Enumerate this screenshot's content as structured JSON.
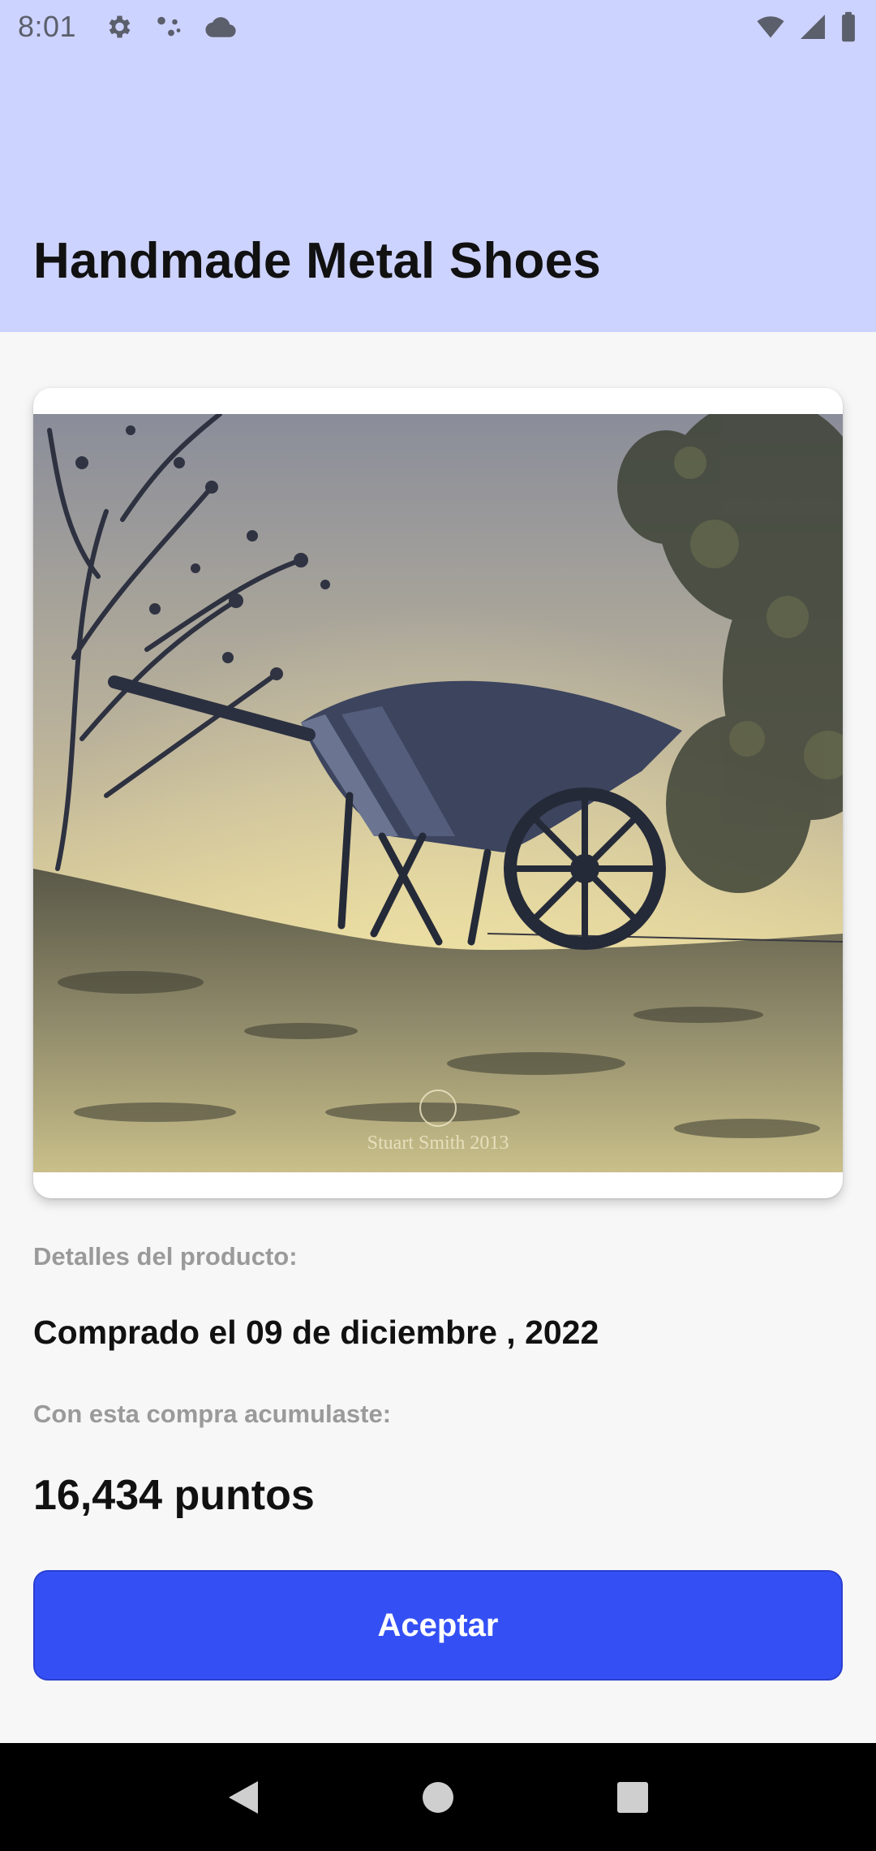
{
  "status_bar": {
    "time": "8:01",
    "left_icons": [
      "gear-icon",
      "assistant-dots-icon",
      "cloud-icon"
    ],
    "right_icons": [
      "wifi-icon",
      "cell-signal-icon",
      "battery-icon"
    ]
  },
  "header": {
    "title": "Handmade Metal Shoes",
    "background": "#cdd3ff"
  },
  "product": {
    "image": "photo-wheelbarrow",
    "image_watermark": "Stuart Smith 2013",
    "details_label": "Detalles del producto:",
    "purchase_date": "Comprado el 09 de diciembre , 2022",
    "accumulated_label": "Con esta compra acumulaste:",
    "points": "16,434 puntos"
  },
  "actions": {
    "accept_label": "Aceptar",
    "accent": "#3450f5"
  },
  "nav_bar": {
    "icons": [
      "back-icon",
      "home-icon",
      "recents-icon"
    ]
  }
}
